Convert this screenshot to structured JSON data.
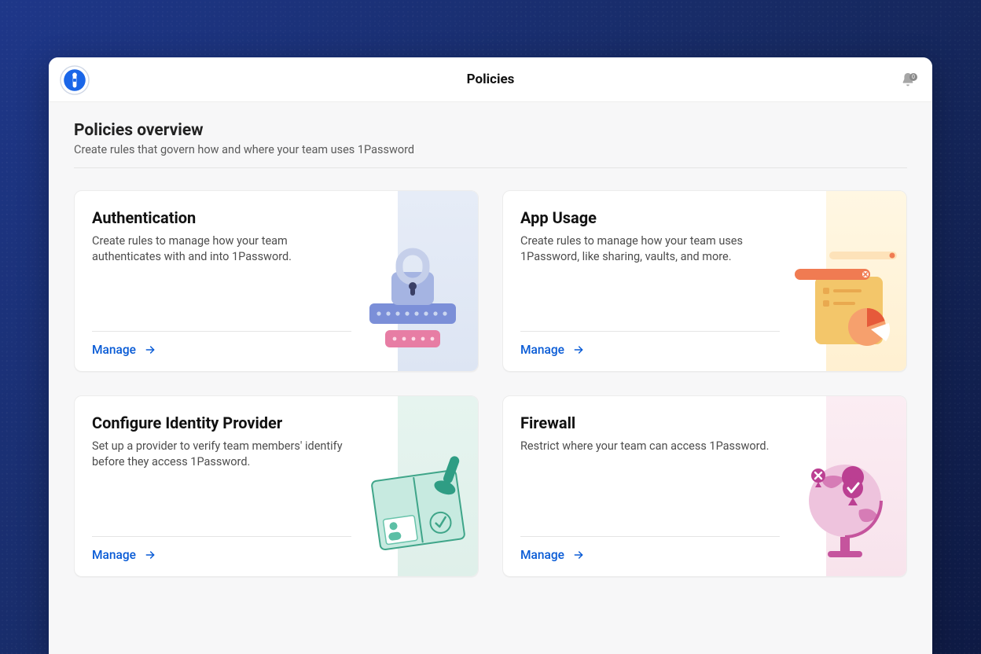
{
  "header": {
    "title": "Policies",
    "notification_count": "0"
  },
  "overview": {
    "heading": "Policies overview",
    "subtext": "Create rules that govern how and where your team uses 1Password"
  },
  "cards": {
    "authentication": {
      "title": "Authentication",
      "desc": "Create rules to manage how your team authenticates with and into 1Password.",
      "action": "Manage"
    },
    "app_usage": {
      "title": "App Usage",
      "desc": "Create rules to manage how your team uses 1Password, like sharing, vaults, and more.",
      "action": "Manage"
    },
    "idp": {
      "title": "Configure Identity Provider",
      "desc": "Set up a provider to verify team members' identify before they access 1Password.",
      "action": "Manage"
    },
    "firewall": {
      "title": "Firewall",
      "desc": "Restrict where your team can access 1Password.",
      "action": "Manage"
    }
  }
}
